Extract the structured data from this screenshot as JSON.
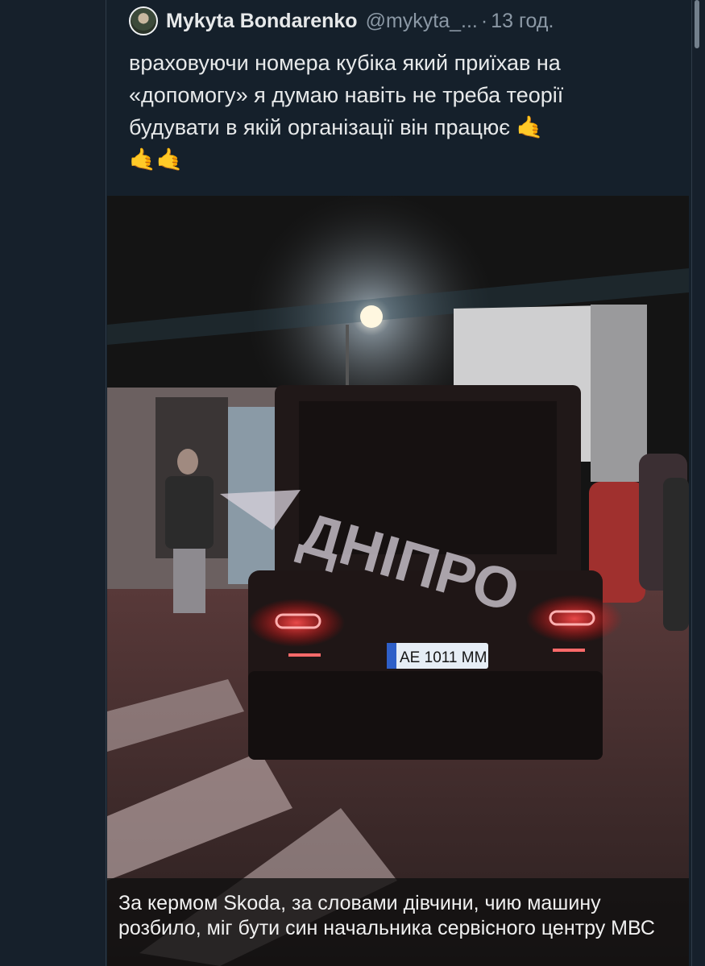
{
  "tweet": {
    "author_name": "Mykyta Bondarenko",
    "author_handle": "@mykyta_...",
    "separator": "·",
    "timestamp": "13 год.",
    "text_line1": "враховуючи номера кубіка який приїхав на",
    "text_line2": "«допомогу» я думаю навіть не треба теорії",
    "text_line3": "будувати в якій організації він працює",
    "emoji": "🤙",
    "emoji_line": "🤙🤙"
  },
  "media": {
    "watermark": "ДНІПРО",
    "license_plate": "AE 1011 MM",
    "caption": "За кермом Skoda, за словами дівчини, чию машину розбило, міг бути син начальника сервісного центру МВС"
  },
  "colors": {
    "background": "#15202b",
    "text": "#e7e9ea",
    "muted": "#8b98a5",
    "emoji": "#f5b72c"
  }
}
